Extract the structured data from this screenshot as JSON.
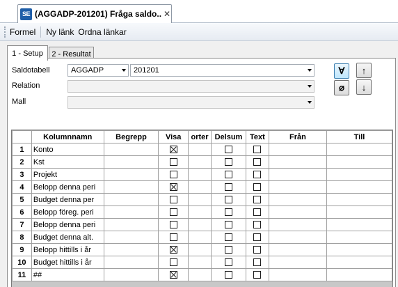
{
  "document_tab": {
    "icon_text": "SE",
    "title": "(AGGADP-201201) Fråga saldo...",
    "close": "✕"
  },
  "toolbar": {
    "formel": "Formel",
    "ny_lank": "Ny länk",
    "ordna_lankar": "Ordna länkar"
  },
  "tabs": {
    "setup": "1 - Setup",
    "resultat": "2 - Resultat"
  },
  "form": {
    "saldotabell_label": "Saldotabell",
    "saldotabell_value": "AGGADP",
    "period_value": "201201",
    "relation_label": "Relation",
    "relation_value": "",
    "mall_label": "Mall",
    "mall_value": ""
  },
  "buttons": {
    "forall": "∀",
    "up": "↑",
    "empty_set": "⌀",
    "down": "↓"
  },
  "grid": {
    "headers": [
      "",
      "Kolumnnamn",
      "Begrepp",
      "Visa",
      "orter",
      "Delsum",
      "Text",
      "Från",
      "Till"
    ],
    "rows": [
      {
        "n": "1",
        "name": "Konto",
        "begrepp": "",
        "visa": true,
        "orter": "",
        "delsum": false,
        "text": false,
        "fran": "",
        "till": ""
      },
      {
        "n": "2",
        "name": "Kst",
        "begrepp": "",
        "visa": false,
        "orter": "",
        "delsum": false,
        "text": false,
        "fran": "",
        "till": ""
      },
      {
        "n": "3",
        "name": "Projekt",
        "begrepp": "",
        "visa": false,
        "orter": "",
        "delsum": false,
        "text": false,
        "fran": "",
        "till": ""
      },
      {
        "n": "4",
        "name": "Belopp denna peri",
        "begrepp": "",
        "visa": true,
        "orter": "",
        "delsum": false,
        "text": false,
        "fran": "",
        "till": ""
      },
      {
        "n": "5",
        "name": "Budget denna per",
        "begrepp": "",
        "visa": false,
        "orter": "",
        "delsum": false,
        "text": false,
        "fran": "",
        "till": ""
      },
      {
        "n": "6",
        "name": "Belopp föreg. peri",
        "begrepp": "",
        "visa": false,
        "orter": "",
        "delsum": false,
        "text": false,
        "fran": "",
        "till": ""
      },
      {
        "n": "7",
        "name": "Belopp denna peri",
        "begrepp": "",
        "visa": false,
        "orter": "",
        "delsum": false,
        "text": false,
        "fran": "",
        "till": ""
      },
      {
        "n": "8",
        "name": "Budget denna alt.",
        "begrepp": "",
        "visa": false,
        "orter": "",
        "delsum": false,
        "text": false,
        "fran": "",
        "till": ""
      },
      {
        "n": "9",
        "name": "Belopp hittills i år",
        "begrepp": "",
        "visa": true,
        "orter": "",
        "delsum": false,
        "text": false,
        "fran": "",
        "till": ""
      },
      {
        "n": "10",
        "name": "Budget hittills i år",
        "begrepp": "",
        "visa": false,
        "orter": "",
        "delsum": false,
        "text": false,
        "fran": "",
        "till": ""
      },
      {
        "n": "11",
        "name": "##",
        "begrepp": "",
        "visa": true,
        "orter": "",
        "delsum": false,
        "text": false,
        "fran": "",
        "till": ""
      }
    ]
  }
}
